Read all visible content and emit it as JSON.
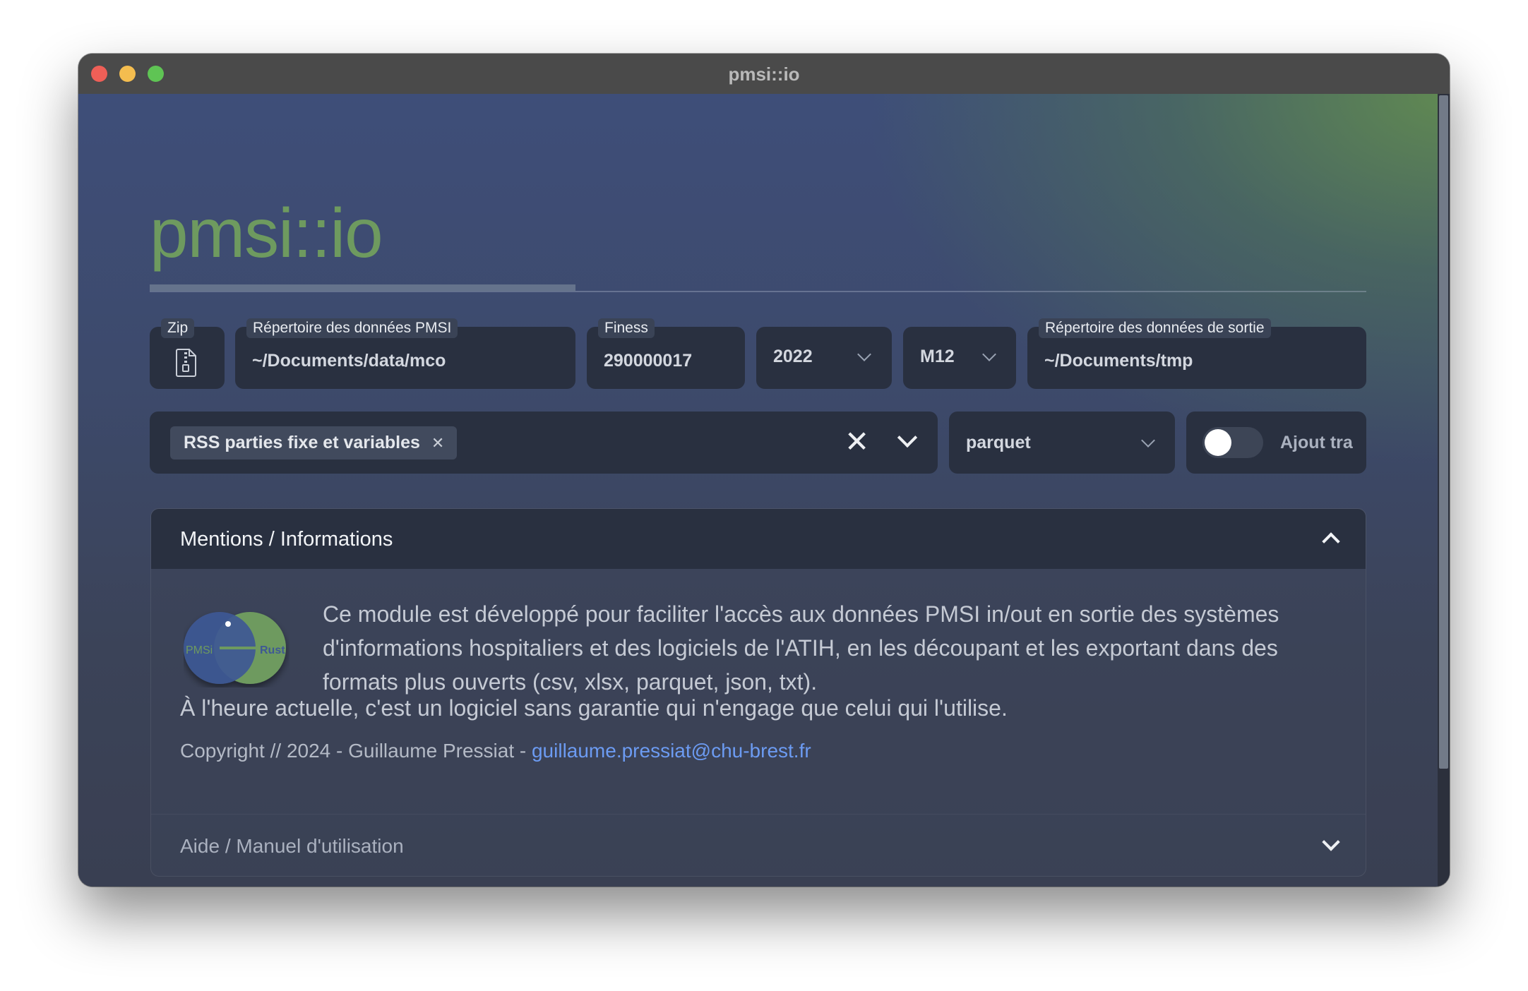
{
  "window": {
    "title": "pmsi::io"
  },
  "app": {
    "title": "pmsi::io"
  },
  "fields": {
    "zip": {
      "label": "Zip"
    },
    "pmsi_dir": {
      "label": "Répertoire des données PMSI",
      "value": "~/Documents/data/mco"
    },
    "finess": {
      "label": "Finess",
      "value": "290000017"
    },
    "year": {
      "value": "2022"
    },
    "month": {
      "value": "M12"
    },
    "output_dir": {
      "label": "Répertoire des données de sortie",
      "value": "~/Documents/tmp"
    }
  },
  "file_types": {
    "selected_chip": "RSS parties fixe et variables"
  },
  "format": {
    "value": "parquet"
  },
  "toggle": {
    "label": "Ajout tra",
    "checked": false
  },
  "mentions": {
    "title": "Mentions / Informations",
    "paragraph": "Ce module est développé pour faciliter l'accès aux données PMSI in/out en sortie des systèmes d'informations hospitaliers et des logiciels de l'ATIH, en les découpant et les exportant dans des formats plus ouverts (csv, xlsx, parquet, json, txt).",
    "disclaimer": "À l'heure actuelle, c'est un logiciel sans garantie qui n'engage que celui qui l'utilise.",
    "copyright": "Copyright // 2024 - Guillaume Pressiat - ",
    "email": "guillaume.pressiat@chu-brest.fr",
    "logo_left": "PMSi",
    "logo_right": "Rust"
  },
  "help": {
    "title": "Aide / Manuel d'utilisation"
  },
  "colors": {
    "accent_green": "#6e9a5f",
    "link_blue": "#6c9bf2",
    "field_bg": "#293040"
  }
}
